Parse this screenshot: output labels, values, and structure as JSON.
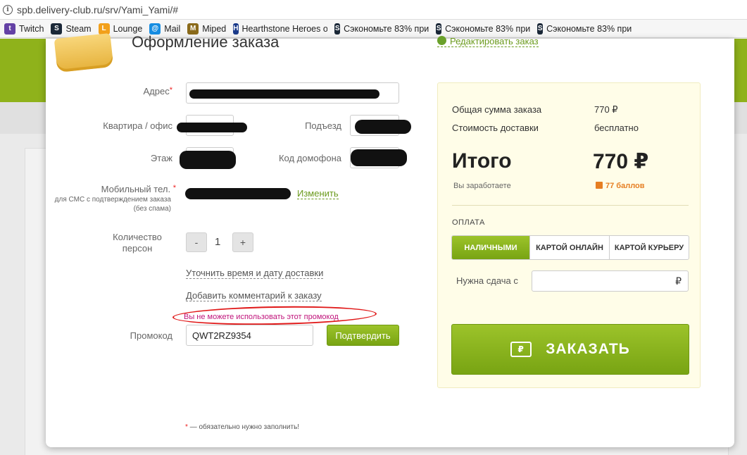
{
  "browser": {
    "url": "spb.delivery-club.ru/srv/Yami_Yami/#",
    "bookmarks": [
      {
        "label": "Twitch",
        "icon": "twitch-icon",
        "color": "#6441a5"
      },
      {
        "label": "Steam",
        "icon": "steam-icon",
        "color": "#1b2838"
      },
      {
        "label": "Lounge",
        "icon": "lounge-icon",
        "color": "#f2a01b"
      },
      {
        "label": "Mail",
        "icon": "mail-icon",
        "color": "#168de2"
      },
      {
        "label": "Miped",
        "icon": "miped-icon",
        "color": "#8a6a1a"
      },
      {
        "label": "Hearthstone Heroes o",
        "icon": "hearthstone-icon",
        "color": "#1a3a8a"
      },
      {
        "label": "Сэкономьте 83% при",
        "icon": "steam-icon",
        "color": "#1b2838"
      },
      {
        "label": "Сэкономьте 83% при",
        "icon": "steam-icon",
        "color": "#1b2838"
      },
      {
        "label": "Сэкономьте 83% при",
        "icon": "steam-icon",
        "color": "#1b2838"
      }
    ]
  },
  "modal": {
    "title": "Оформление заказа",
    "edit_order": "Редактировать заказ"
  },
  "form": {
    "address_label": "Адрес",
    "required_mark": "*",
    "apartment_label": "Квартира / офис",
    "entrance_label": "Подъезд",
    "floor_label": "Этаж",
    "intercom_label": "Код домофона",
    "mobile_label": "Мобильный тел.",
    "mobile_sub": "для СМС с подтверждением заказа (без спама)",
    "change_link": "Изменить",
    "persons_label": "Количество персон",
    "minus": "-",
    "plus": "+",
    "quantity": "1",
    "delivery_time_link": "Уточнить время и дату доставки",
    "comment_link": "Добавить комментарий к заказу",
    "promo_error": "Вы не можете использовать этот промокод",
    "promo_label": "Промокод",
    "promo_value": "QWT2RZ9354",
    "confirm_button": "Подтвердить",
    "required_note": "— обязательно нужно заполнить!"
  },
  "summary": {
    "order_total_label": "Общая сумма заказа",
    "order_total_value": "770 ₽",
    "delivery_label": "Стоимость доставки",
    "delivery_value": "бесплатно",
    "total_label": "Итого",
    "total_value": "770 ₽",
    "earn_label": "Вы заработаете",
    "earn_value": "77 баллов",
    "payment_title": "ОПЛАТА",
    "payment_tabs": [
      "НАЛИЧНЫМИ",
      "КАРТОЙ ОНЛАЙН",
      "КАРТОЙ КУРЬЕРУ"
    ],
    "change_label": "Нужна сдача с",
    "currency": "₽",
    "order_button": "ЗАКАЗАТЬ"
  },
  "colors": {
    "accent_green": "#8fb21b",
    "error_red": "#e01818",
    "bonus_orange": "#e67e22"
  }
}
